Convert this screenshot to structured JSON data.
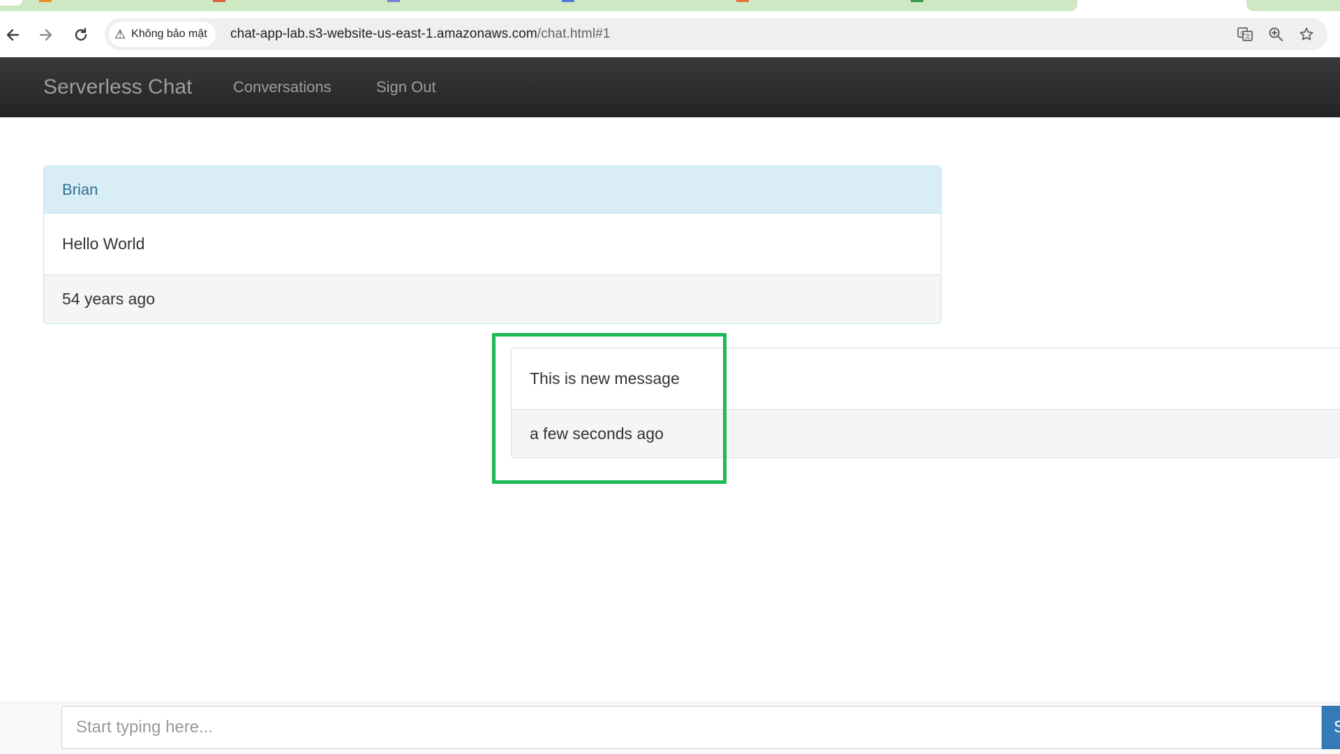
{
  "browser": {
    "security_label": "Không bảo mật",
    "url_host": "chat-app-lab.s3-website-us-east-1.amazonaws.com",
    "url_path": "/chat.html#1",
    "tab_colors": [
      "#f28b22",
      "#d9603b",
      "#7b7fd4",
      "#4f79d9",
      "#e8713b",
      "#3c9a4a"
    ]
  },
  "navbar": {
    "brand": "Serverless Chat",
    "links": [
      "Conversations",
      "Sign Out"
    ]
  },
  "messages": [
    {
      "sender": "Brian",
      "text": "Hello World",
      "time": "54 years ago"
    },
    {
      "text": "This is new message",
      "time": "a few seconds ago"
    }
  ],
  "composer": {
    "placeholder": "Start typing here...",
    "send_label": "Send"
  },
  "colors": {
    "highlight": "#1db954",
    "navbar": "#222222",
    "panel_heading": "#d9edf7"
  }
}
